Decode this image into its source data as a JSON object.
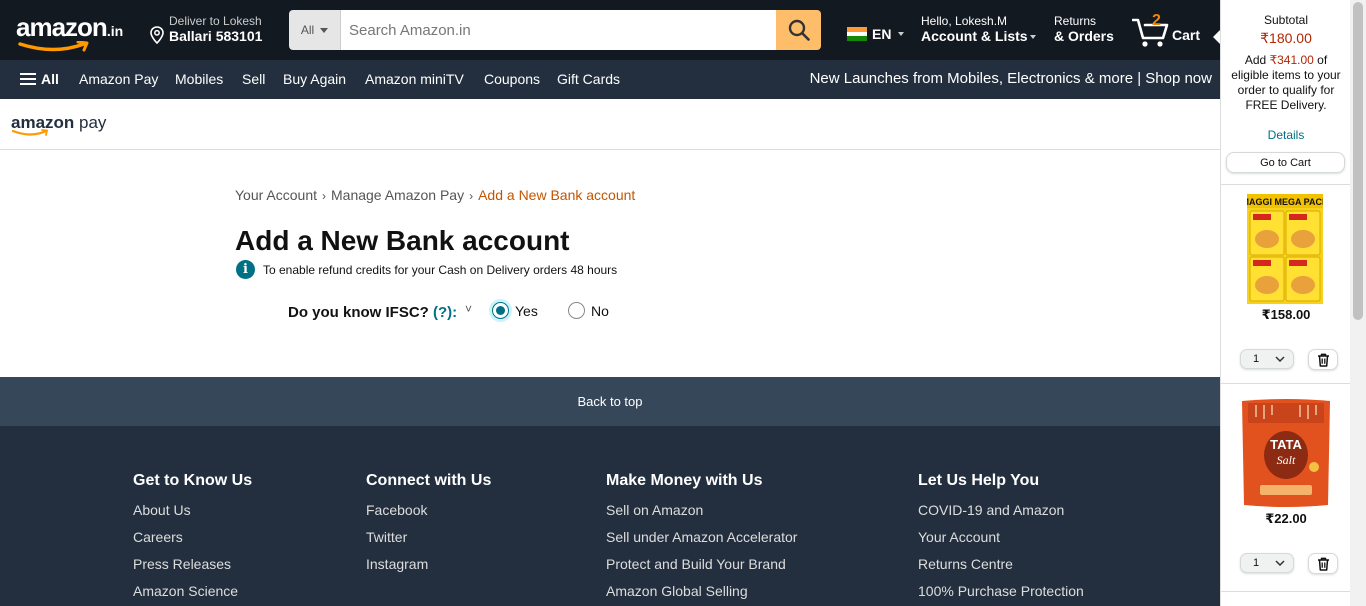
{
  "header": {
    "logo_text": "amazon",
    "logo_tld": ".in",
    "deliver_line1": "Deliver to Lokesh",
    "deliver_line2": "Ballari 583101",
    "search_category": "All",
    "search_placeholder": "Search Amazon.in",
    "language": "EN",
    "account_line1": "Hello, Lokesh.M",
    "account_line2": "Account & Lists",
    "orders_line1": "Returns",
    "orders_line2": "& Orders",
    "cart_count": "2",
    "cart_label": "Cart"
  },
  "subnav": {
    "all_label": "All",
    "items": [
      "Amazon Pay",
      "Mobiles",
      "Sell",
      "Buy Again",
      "Amazon miniTV",
      "Coupons",
      "Gift Cards"
    ],
    "promo": "New Launches from Mobiles, Electronics & more | Shop now"
  },
  "pay_header": {
    "logo_a": "amazon",
    "logo_b": " pay"
  },
  "breadcrumb": {
    "items": [
      "Your Account",
      "Manage Amazon Pay",
      "Add a New Bank account"
    ],
    "separator": "›"
  },
  "main": {
    "title": "Add a New Bank account",
    "info_icon": "i",
    "info_text": "To enable refund credits for your Cash on Delivery orders 48 hours",
    "ifsc_question": "Do you know IFSC?",
    "ifsc_help": "(?):",
    "chevron": "˅",
    "options": [
      "Yes",
      "No"
    ],
    "selected": "Yes"
  },
  "footer": {
    "back_to_top": "Back to top",
    "columns": [
      {
        "heading": "Get to Know Us",
        "links": [
          "About Us",
          "Careers",
          "Press Releases",
          "Amazon Science"
        ]
      },
      {
        "heading": "Connect with Us",
        "links": [
          "Facebook",
          "Twitter",
          "Instagram"
        ]
      },
      {
        "heading": "Make Money with Us",
        "links": [
          "Sell on Amazon",
          "Sell under Amazon Accelerator",
          "Protect and Build Your Brand",
          "Amazon Global Selling"
        ]
      },
      {
        "heading": "Let Us Help You",
        "links": [
          "COVID-19 and Amazon",
          "Your Account",
          "Returns Centre",
          "100% Purchase Protection"
        ]
      }
    ]
  },
  "cart_panel": {
    "subtotal_label": "Subtotal",
    "subtotal_amount": "₹180.00",
    "msg_pre": "Add ",
    "msg_amount": "₹341.00",
    "msg_post": " of eligible items to your order to qualify for FREE Delivery.",
    "details_label": "Details",
    "go_to_cart": "Go to Cart",
    "products": [
      {
        "name": "Maggi Mega Pack",
        "image_text": "MAGGI MEGA PACK",
        "price": "₹158.00",
        "qty": "1"
      },
      {
        "name": "Tata Salt",
        "image_text": "TATA Salt",
        "price": "₹22.00",
        "qty": "1"
      }
    ]
  },
  "colors": {
    "nav_dark": "#131921",
    "nav_sub": "#232f3e",
    "search_button": "#febd69",
    "accent_orange": "#c45500",
    "link_teal": "#007185",
    "price_red": "#b12704"
  },
  "icons": [
    "location-pin-icon",
    "search-icon",
    "cart-icon",
    "hamburger-icon",
    "info-icon",
    "trash-icon",
    "chevron-down-icon"
  ]
}
